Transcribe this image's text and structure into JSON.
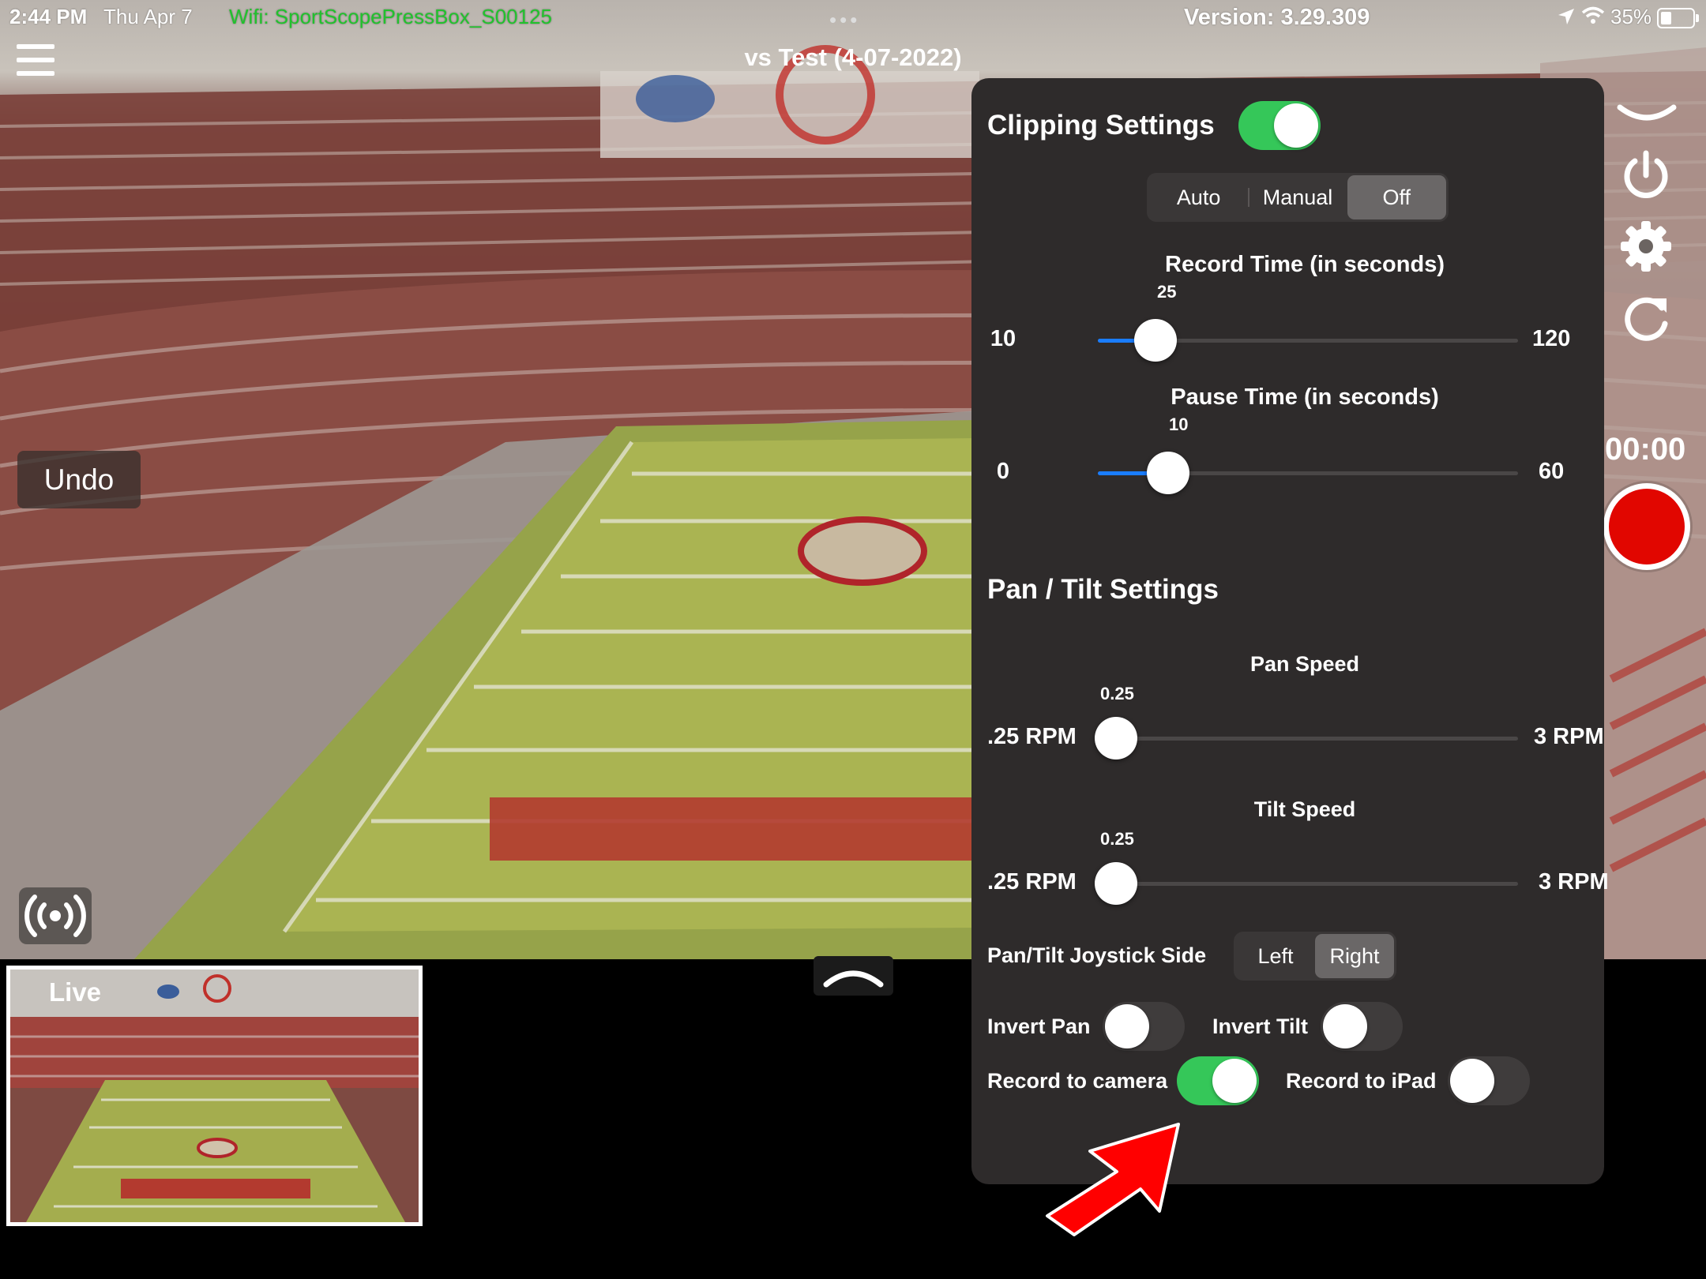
{
  "status_bar": {
    "time": "2:44 PM",
    "date": "Thu Apr 7",
    "wifi": "Wifi: SportScopePressBox_S00125",
    "version": "Version: 3.29.309",
    "battery": "35%",
    "battery_level": 0.35
  },
  "header": {
    "title": "vs Test (4-07-2022)"
  },
  "overlay": {
    "undo_label": "Undo",
    "live_label": "Live"
  },
  "right_column": {
    "timer": "00:00"
  },
  "clipping": {
    "title": "Clipping Settings",
    "enabled": true,
    "mode_options": [
      "Auto",
      "Manual",
      "Off"
    ],
    "mode_selected": "Off",
    "record_time": {
      "label": "Record Time (in seconds)",
      "value": 25,
      "min": 10,
      "max": 120,
      "value_text": "25",
      "min_text": "10",
      "max_text": "120"
    },
    "pause_time": {
      "label": "Pause Time (in seconds)",
      "value": 10,
      "min": 0,
      "max": 60,
      "value_text": "10",
      "min_text": "0",
      "max_text": "60"
    }
  },
  "pan_tilt": {
    "title": "Pan / Tilt Settings",
    "pan_speed": {
      "label": "Pan Speed",
      "value": 0.25,
      "min": 0.25,
      "max": 3,
      "value_text": "0.25",
      "min_text": ".25 RPM",
      "max_text": "3 RPM"
    },
    "tilt_speed": {
      "label": "Tilt Speed",
      "value": 0.25,
      "min": 0.25,
      "max": 3,
      "value_text": "0.25",
      "min_text": ".25 RPM",
      "max_text": "3 RPM"
    },
    "joystick_side": {
      "label": "Pan/Tilt Joystick Side",
      "options": [
        "Left",
        "Right"
      ],
      "selected": "Right"
    },
    "invert_pan": {
      "label": "Invert Pan",
      "on": false
    },
    "invert_tilt": {
      "label": "Invert Tilt",
      "on": false
    },
    "record_to_camera": {
      "label": "Record to camera",
      "on": true
    },
    "record_to_ipad": {
      "label": "Record to iPad",
      "on": false
    }
  },
  "colors": {
    "accent_green": "#35c759",
    "slider_blue": "#1a7dff",
    "record_red": "#e10600",
    "panel_bg": "#2e2b2b",
    "wifi_green": "#21c22d",
    "arrow_red": "#ff0000"
  },
  "icons": [
    "hamburger-icon",
    "chevron-down-icon",
    "power-icon",
    "gear-icon",
    "refresh-icon",
    "broadcast-icon",
    "chevron-up-icon",
    "location-arrow-icon",
    "wifi-icon",
    "battery-icon",
    "annotation-arrow-icon"
  ]
}
